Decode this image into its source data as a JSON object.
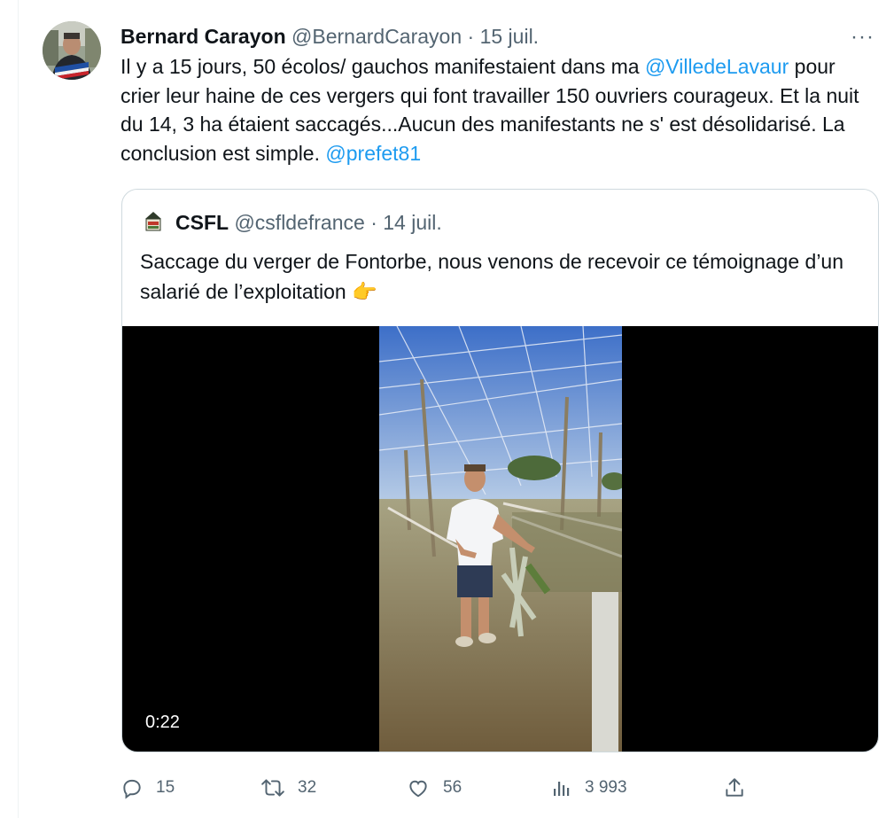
{
  "tweet": {
    "author_name": "Bernard Carayon",
    "handle": "@BernardCarayon",
    "separator": "·",
    "date": "15 juil.",
    "more_label": "···",
    "text_part1": "Il y a 15 jours, 50 écolos/ gauchos manifestaient dans ma ",
    "mention1": "@VilledeLavaur",
    "text_part2": " pour crier leur haine de ces vergers qui font travailler 150 ouvriers courageux. Et la nuit du 14, 3 ha étaient saccagés...Aucun des manifestants  ne s' est désolidarisé. La conclusion est simple. ",
    "mention2": "@prefet81"
  },
  "quote": {
    "author_name": "CSFL",
    "handle": "@csfldefrance",
    "separator": "·",
    "date": "14 juil.",
    "text": "Saccage du verger de Fontorbe, nous venons de recevoir ce témoignage d’un salarié de l’exploitation",
    "emoji": "👉",
    "video_duration": "0:22"
  },
  "actions": {
    "replies": "15",
    "retweets": "32",
    "likes": "56",
    "views": "3 993"
  },
  "icons": [
    "reply-icon",
    "retweet-icon",
    "like-icon",
    "views-icon",
    "share-icon"
  ],
  "colors": {
    "link": "#1d9bf0",
    "muted": "#536471",
    "text": "#0f1419",
    "border": "#cfd9de"
  }
}
